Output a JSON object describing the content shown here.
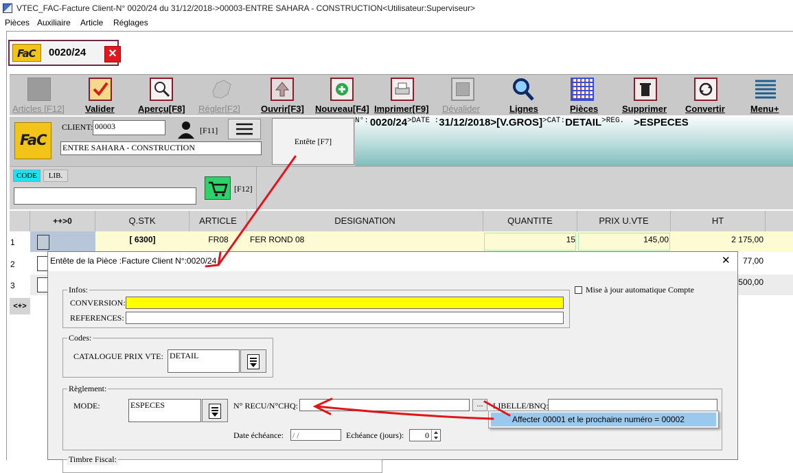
{
  "window": {
    "title": "VTEC_FAC-Facture Client-N° 0020/24 du 31/12/2018->00003-ENTRE SAHARA - CONSTRUCTION<Utilisateur:Superviseur>"
  },
  "menu": {
    "items": [
      "Pièces",
      "Auxiliaire",
      "Article",
      "Réglages"
    ]
  },
  "doc_tab": {
    "icon_text": "FaC",
    "number": "0020/24",
    "close": "✕"
  },
  "toolbar": {
    "items": [
      {
        "label": "Articles [F12]",
        "icon": "articles-icon",
        "enabled": false
      },
      {
        "label": "Valider",
        "icon": "validate-check-icon",
        "enabled": true
      },
      {
        "label": "Aperçu[F8]",
        "icon": "preview-magnifier-icon",
        "enabled": true
      },
      {
        "label": "Régler[F2]",
        "icon": "settle-map-icon",
        "enabled": false
      },
      {
        "label": "Ouvrir[F3]",
        "icon": "open-arrow-up-icon",
        "enabled": true
      },
      {
        "label": "Nouveau[F4]",
        "icon": "new-plus-icon",
        "enabled": true
      },
      {
        "label": "Imprimer[F9]",
        "icon": "printer-icon",
        "enabled": true
      },
      {
        "label": "Dévalider",
        "icon": "unvalidate-icon",
        "enabled": false
      },
      {
        "label": "Lignes",
        "icon": "lines-search-icon",
        "enabled": true
      },
      {
        "label": "Pièces",
        "icon": "pieces-grid-icon",
        "enabled": true
      },
      {
        "label": "Supprimer",
        "icon": "trash-icon",
        "enabled": true
      },
      {
        "label": "Convertir",
        "icon": "convert-cycle-icon",
        "enabled": true
      },
      {
        "label": "Menu+",
        "icon": "menu-lines-icon",
        "enabled": true
      }
    ]
  },
  "client": {
    "label": "CLIENT:",
    "code": "00003",
    "name": "ENTRE SAHARA - CONSTRUCTION",
    "person_key": "[F11]",
    "entete_button": "Entête [F7]"
  },
  "header_info": {
    "n_label": "N°:",
    "number": "0020/24",
    "date_label": ">DATE :",
    "date": "31/12/2018",
    "tarif": ">[V.GROS]",
    "cat_label": ">CAT:",
    "cat": "DETAIL",
    "reg_label": ">REG.",
    "reg": ">ESPECES"
  },
  "search": {
    "tab_code": "CODE",
    "tab_lib": "LIB.",
    "cart_key": "[F12]",
    "value": ""
  },
  "grid": {
    "columns": [
      "++>0",
      "Q.STK",
      "ARTICLE",
      "DESIGNATION",
      "QUANTITE",
      "PRIX U.VTE",
      "HT"
    ],
    "rows": [
      {
        "num": "1",
        "qstk": "[ 6300]",
        "article": "FR08",
        "designation": "FER ROND 08",
        "quantite": "15",
        "prix": "145,00",
        "ht": "2 175,00"
      },
      {
        "num": "2",
        "ht": "77,00"
      },
      {
        "num": "3",
        "ht": "500,00"
      }
    ],
    "footer_marker": "<+>"
  },
  "dialog": {
    "title": "Entête de la Pièce :Facture Client N°:0020/24",
    "close": "✕",
    "infos": {
      "legend": "Infos:",
      "conversion_label": "CONVERSION:",
      "conversion_value": "",
      "references_label": "REFERENCES:",
      "references_value": ""
    },
    "auto_update_label": "Mise à jour automatique Compte",
    "codes": {
      "legend": "Codes:",
      "catalogue_label": "CATALOGUE PRIX VTE:",
      "catalogue_value": "DETAIL"
    },
    "reglement": {
      "legend": "Règlement:",
      "mode_label": "MODE:",
      "mode_value": "ESPECES",
      "recu_label": "N° RECU/N°CHQ:",
      "recu_value": "",
      "ellipsis": "...",
      "libelle_label": "LIBELLE/BNQ:",
      "libelle_value": "",
      "date_label": "Date échéance:",
      "date_value": " / /",
      "echeance_label": "Echéance (jours):",
      "echeance_value": "0"
    },
    "timbre_legend": "Timbre Fiscal:"
  },
  "popup": {
    "item": "Affecter 00001 et le prochaine numéro = 00002"
  },
  "colors": {
    "accent_red": "#e0151c",
    "fac_yellow": "#f2c418",
    "teal": "#7ebebc",
    "highlight_yellow": "#ffff00",
    "popup_blue": "#99c9ef"
  }
}
